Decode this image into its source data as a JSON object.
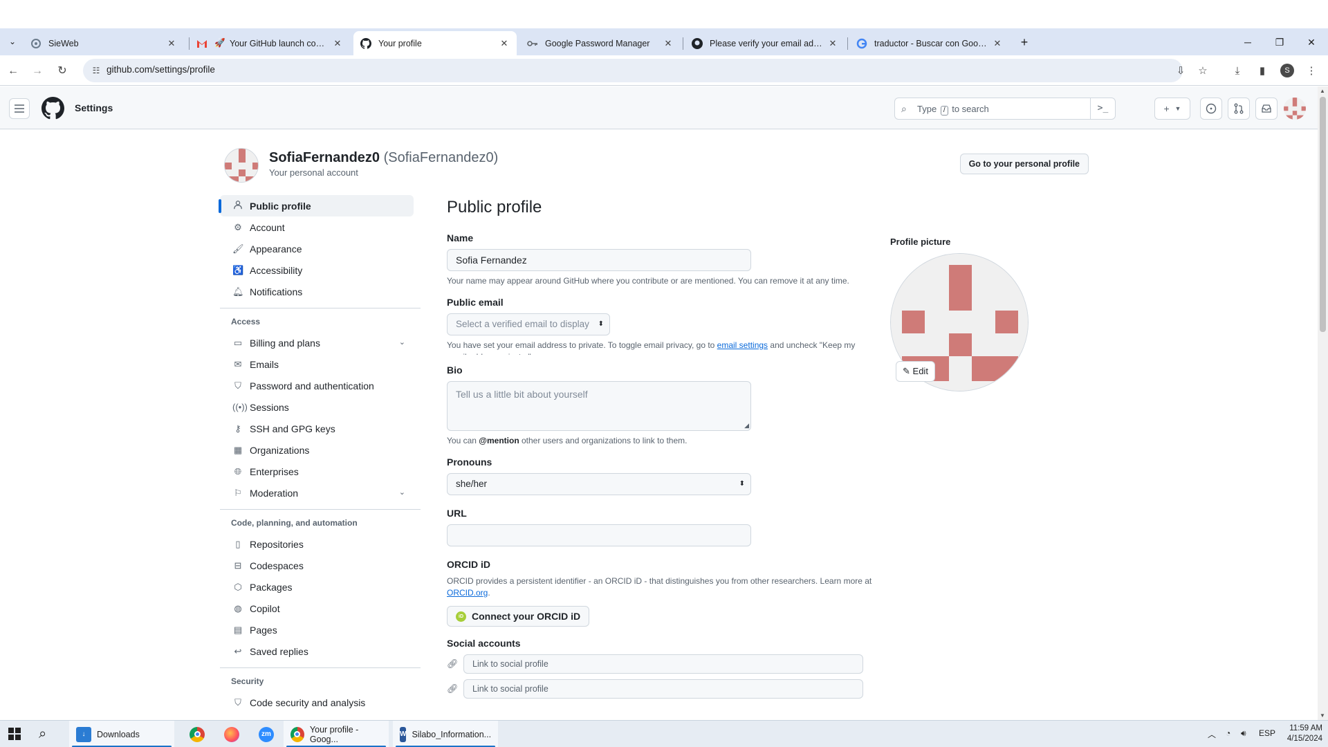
{
  "browser": {
    "tabs": [
      {
        "title": "SieWeb",
        "icon": "sieweb-icon"
      },
      {
        "title": "Your GitHub launch code - ",
        "icon": "gmail-icon"
      },
      {
        "title": "Your profile",
        "icon": "github-icon",
        "active": true
      },
      {
        "title": "Google Password Manager",
        "icon": "key-icon"
      },
      {
        "title": "Please verify your email address",
        "icon": "github-icon"
      },
      {
        "title": "traductor - Buscar con Google",
        "icon": "google-icon"
      }
    ],
    "url": "github.com/settings/profile",
    "profile_initial": "S"
  },
  "github": {
    "context": "Settings",
    "search_placeholder_pre": "Type",
    "search_key": "/",
    "search_placeholder_post": "to search"
  },
  "account": {
    "display_name": "SofiaFernandez0",
    "login": "(SofiaFernandez0)",
    "subtitle": "Your personal account",
    "goto_button": "Go to your personal profile"
  },
  "sidebar": {
    "items_top": [
      {
        "label": "Public profile",
        "icon": "person-icon",
        "selected": true
      },
      {
        "label": "Account",
        "icon": "gear-icon"
      },
      {
        "label": "Appearance",
        "icon": "paintbrush-icon"
      },
      {
        "label": "Accessibility",
        "icon": "accessibility-icon"
      },
      {
        "label": "Notifications",
        "icon": "bell-icon"
      }
    ],
    "access_title": "Access",
    "items_access": [
      {
        "label": "Billing and plans",
        "icon": "credit-card-icon",
        "chevron": true
      },
      {
        "label": "Emails",
        "icon": "mail-icon"
      },
      {
        "label": "Password and authentication",
        "icon": "shield-icon"
      },
      {
        "label": "Sessions",
        "icon": "broadcast-icon"
      },
      {
        "label": "SSH and GPG keys",
        "icon": "key-icon"
      },
      {
        "label": "Organizations",
        "icon": "organization-icon"
      },
      {
        "label": "Enterprises",
        "icon": "globe-icon"
      },
      {
        "label": "Moderation",
        "icon": "report-icon",
        "chevron": true
      }
    ],
    "code_title": "Code, planning, and automation",
    "items_code": [
      {
        "label": "Repositories",
        "icon": "repo-icon"
      },
      {
        "label": "Codespaces",
        "icon": "codespaces-icon"
      },
      {
        "label": "Packages",
        "icon": "package-icon"
      },
      {
        "label": "Copilot",
        "icon": "copilot-icon"
      },
      {
        "label": "Pages",
        "icon": "browser-icon"
      },
      {
        "label": "Saved replies",
        "icon": "reply-icon"
      }
    ],
    "security_title": "Security",
    "items_security": [
      {
        "label": "Code security and analysis",
        "icon": "shield-check-icon"
      }
    ]
  },
  "profile": {
    "title": "Public profile",
    "name_label": "Name",
    "name_value": "Sofia Fernandez",
    "name_note": "Your name may appear around GitHub where you contribute or are mentioned. You can remove it at any time.",
    "email_label": "Public email",
    "email_select": "Select a verified email to display",
    "email_note_pre": "You have set your email address to private. To toggle email privacy, go to",
    "email_note_link": "email settings",
    "email_note_post": "and uncheck \"Keep my email address private.\"",
    "bio_label": "Bio",
    "bio_placeholder": "Tell us a little bit about yourself",
    "bio_note_pre": "You can",
    "bio_note_mention": "@mention",
    "bio_note_post": "other users and organizations to link to them.",
    "pronouns_label": "Pronouns",
    "pronouns_value": "she/her",
    "url_label": "URL",
    "url_value": "",
    "orcid_label": "ORCID iD",
    "orcid_note_pre": "ORCID provides a persistent identifier - an ORCID iD - that distinguishes you from other researchers. Learn more at",
    "orcid_note_link": "ORCID.org",
    "orcid_note_post": ".",
    "orcid_button": "Connect your ORCID iD",
    "orcid_badge": "iD",
    "social_label": "Social accounts",
    "social_placeholder": "Link to social profile",
    "picture_label": "Profile picture",
    "edit_button": "Edit"
  },
  "taskbar": {
    "apps": [
      {
        "label": "Downloads",
        "icon": "folder-download-icon"
      },
      {
        "label": "",
        "icon": "chrome-icon"
      },
      {
        "label": "",
        "icon": "firefox-icon"
      },
      {
        "label": "",
        "icon": "zoom-icon",
        "text": "zm"
      },
      {
        "label": "Your profile - Goog...",
        "icon": "chrome-icon",
        "active": true
      },
      {
        "label": "Silabo_Information...",
        "icon": "word-icon",
        "text": "W"
      }
    ],
    "lang": "ESP",
    "time": "11:59 AM",
    "date": "4/15/2024"
  },
  "colors": {
    "accent": "#0969da",
    "avatar_block": "#cf7b78",
    "tabbar": "#dce5f5"
  }
}
